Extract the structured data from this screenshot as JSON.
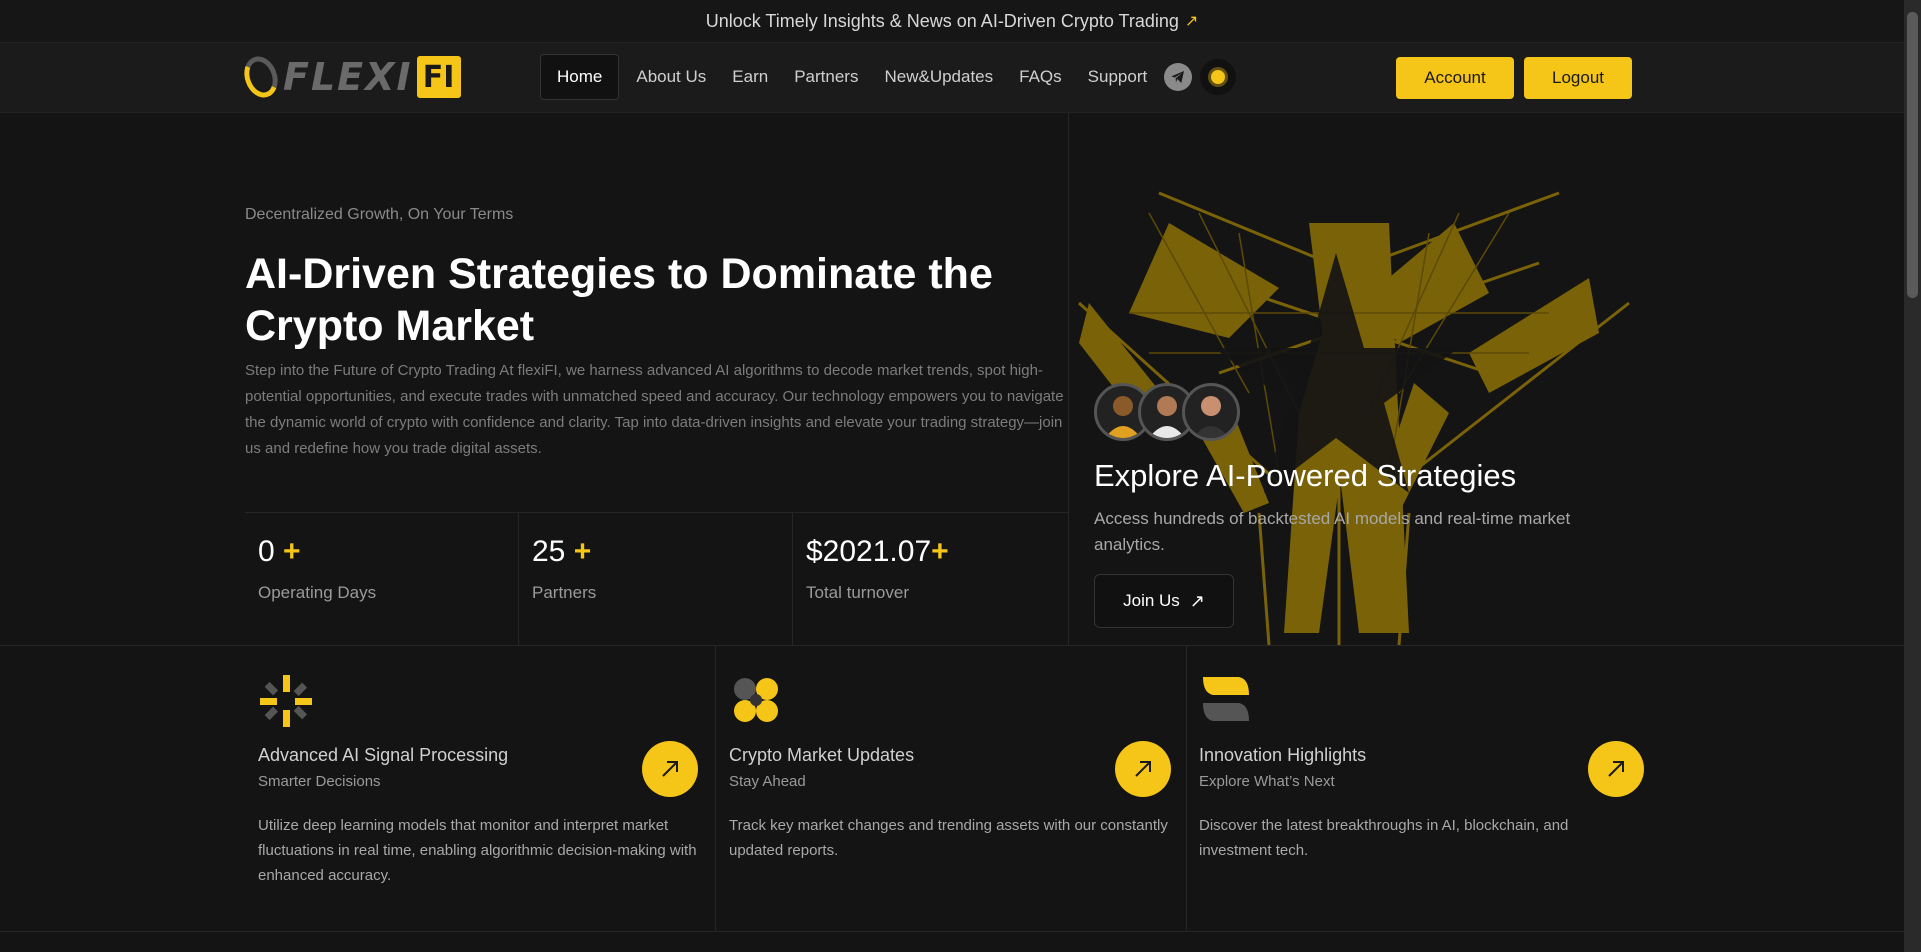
{
  "announcement": {
    "text": "Unlock Timely Insights & News on AI-Driven Crypto Trading",
    "arrow": "↗"
  },
  "logo": {
    "text": "FLEXI",
    "badge": "FI"
  },
  "nav": {
    "items": [
      "Home",
      "About Us",
      "Earn",
      "Partners",
      "New&Updates",
      "FAQs",
      "Support"
    ],
    "active": "Home",
    "icons": [
      "telegram-icon",
      "sun-icon"
    ],
    "account_label": "Account",
    "logout_label": "Logout"
  },
  "hero": {
    "tagline": "Decentralized Growth, On Your Terms",
    "headline": "AI-Driven Strategies to Dominate the Crypto Market",
    "description": "Step into the Future of Crypto Trading At flexiFI, we harness advanced AI algorithms to decode market trends, spot high-potential opportunities, and execute trades with unmatched speed and accuracy. Our technology empowers you to navigate the dynamic world of crypto with confidence and clarity. Tap into data-driven insights and elevate your trading strategy—join us and redefine how you trade digital assets."
  },
  "stats": [
    {
      "value": "0",
      "plus": "+",
      "label": "Operating Days"
    },
    {
      "value": "25",
      "plus": "+",
      "label": "Partners"
    },
    {
      "value": "$2021.07",
      "plus": "+",
      "label": "Total turnover"
    }
  ],
  "explore": {
    "title": "Explore AI-Powered Strategies",
    "description": "Access hundreds of backtested AI models and real-time market analytics.",
    "join_label": "Join Us"
  },
  "features": [
    {
      "title": "Advanced AI Signal Processing",
      "subtitle": "Smarter Decisions",
      "description": "Utilize deep learning models that monitor and interpret market fluctuations in real time, enabling algorithmic decision-making with enhanced accuracy.",
      "icon": "spark-icon"
    },
    {
      "title": "Crypto Market Updates",
      "subtitle": "Stay Ahead",
      "description": "Track key market changes and trending assets with our constantly updated reports.",
      "icon": "circles-icon"
    },
    {
      "title": "Innovation Highlights",
      "subtitle": "Explore What’s Next",
      "description": "Discover the latest breakthroughs in AI, blockchain, and investment tech.",
      "icon": "leaf-icon"
    }
  ],
  "colors": {
    "accent": "#f5c518",
    "background": "#141414",
    "surface": "#1b1b1b"
  }
}
